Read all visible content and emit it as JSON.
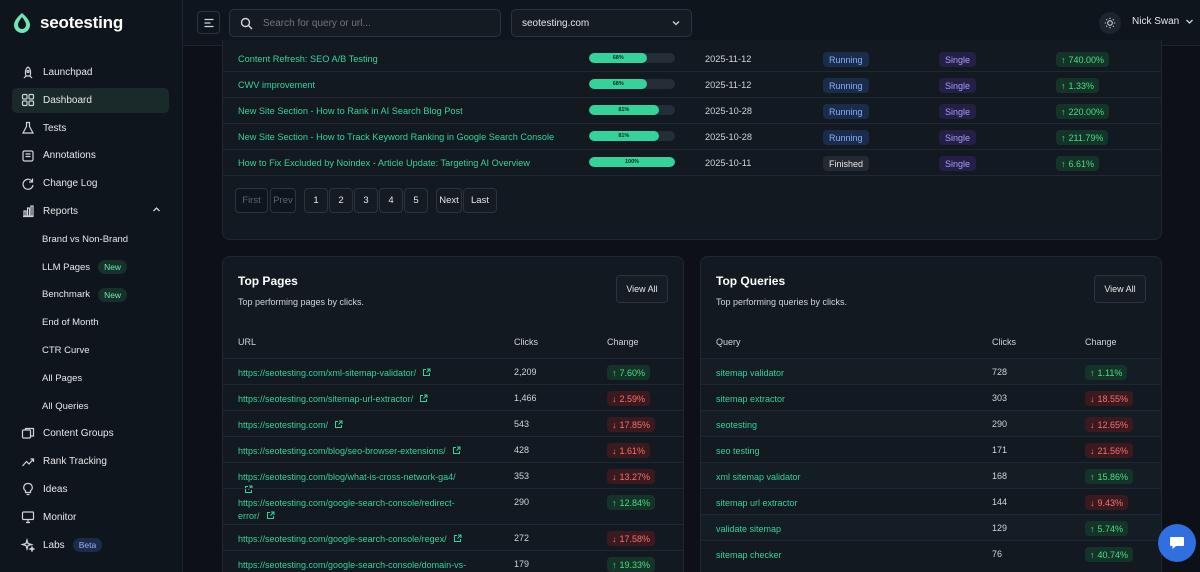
{
  "brand": {
    "name": "seotesting"
  },
  "nav": {
    "items": [
      {
        "label": "Launchpad"
      },
      {
        "label": "Dashboard"
      },
      {
        "label": "Tests"
      },
      {
        "label": "Annotations"
      },
      {
        "label": "Change Log"
      },
      {
        "label": "Reports"
      }
    ],
    "reports_sub": [
      {
        "label": "Brand vs Non-Brand"
      },
      {
        "label": "LLM Pages",
        "pill": "New"
      },
      {
        "label": "Benchmark",
        "pill": "New"
      },
      {
        "label": "End of Month"
      },
      {
        "label": "CTR Curve"
      },
      {
        "label": "All Pages"
      },
      {
        "label": "All Queries"
      }
    ],
    "bottom_items": [
      {
        "label": "Content Groups"
      },
      {
        "label": "Rank Tracking"
      },
      {
        "label": "Ideas"
      },
      {
        "label": "Monitor"
      },
      {
        "label": "Labs",
        "pill": "Beta"
      }
    ]
  },
  "topbar": {
    "search_placeholder": "Search for query or url...",
    "site": "seotesting.com",
    "user": "Nick Swan"
  },
  "tests": [
    {
      "name": "Content Refresh: SEO A/B Testing",
      "progress": 68,
      "progress_label": "68%",
      "date": "2025-11-12",
      "status": "Running",
      "type": "Single",
      "change": "740.00%",
      "dir": "up"
    },
    {
      "name": "CWV improvement",
      "progress": 68,
      "progress_label": "68%",
      "date": "2025-11-12",
      "status": "Running",
      "type": "Single",
      "change": "1.33%",
      "dir": "up"
    },
    {
      "name": "New Site Section - How to Rank in AI Search Blog Post",
      "progress": 81,
      "progress_label": "81%",
      "date": "2025-10-28",
      "status": "Running",
      "type": "Single",
      "change": "220.00%",
      "dir": "up"
    },
    {
      "name": "New Site Section - How to Track Keyword Ranking in Google Search Console",
      "progress": 81,
      "progress_label": "81%",
      "date": "2025-10-28",
      "status": "Running",
      "type": "Single",
      "change": "211.79%",
      "dir": "up"
    },
    {
      "name": "How to Fix Excluded by Noindex - Article Update: Targeting AI Overview",
      "progress": 100,
      "progress_label": "100%",
      "date": "2025-10-11",
      "status": "Finished",
      "type": "Single",
      "change": "6.61%",
      "dir": "up"
    }
  ],
  "pager": {
    "first": "First",
    "prev": "Prev",
    "pages": [
      "1",
      "2",
      "3",
      "4",
      "5"
    ],
    "next": "Next",
    "last": "Last"
  },
  "top_pages": {
    "title": "Top Pages",
    "subtitle": "Top performing pages by clicks.",
    "view_all": "View All",
    "headers": {
      "col1": "URL",
      "col2": "Clicks",
      "col3": "Change"
    },
    "rows": [
      {
        "url": "https://seotesting.com/xml-sitemap-validator/",
        "clicks": "2,209",
        "change": "7.60%",
        "dir": "up"
      },
      {
        "url": "https://seotesting.com/sitemap-url-extractor/",
        "clicks": "1,466",
        "change": "2.59%",
        "dir": "down"
      },
      {
        "url": "https://seotesting.com/",
        "clicks": "543",
        "change": "17.85%",
        "dir": "down"
      },
      {
        "url": "https://seotesting.com/blog/seo-browser-extensions/",
        "clicks": "428",
        "change": "1.61%",
        "dir": "down"
      },
      {
        "url": "https://seotesting.com/blog/what-is-cross-network-ga4/",
        "clicks": "353",
        "change": "13.27%",
        "dir": "down"
      },
      {
        "url": "https://seotesting.com/google-search-console/redirect-error/",
        "clicks": "290",
        "change": "12.84%",
        "dir": "up"
      },
      {
        "url": "https://seotesting.com/google-search-console/regex/",
        "clicks": "272",
        "change": "17.58%",
        "dir": "down"
      },
      {
        "url": "https://seotesting.com/google-search-console/domain-vs-",
        "clicks": "179",
        "change": "19.33%",
        "dir": "up"
      }
    ]
  },
  "top_queries": {
    "title": "Top Queries",
    "subtitle": "Top performing queries by clicks.",
    "view_all": "View All",
    "headers": {
      "col1": "Query",
      "col2": "Clicks",
      "col3": "Change"
    },
    "rows": [
      {
        "query": "sitemap validator",
        "clicks": "728",
        "change": "1.11%",
        "dir": "up"
      },
      {
        "query": "sitemap extractor",
        "clicks": "303",
        "change": "18.55%",
        "dir": "down"
      },
      {
        "query": "seotesting",
        "clicks": "290",
        "change": "12.65%",
        "dir": "down"
      },
      {
        "query": "seo testing",
        "clicks": "171",
        "change": "21.56%",
        "dir": "down"
      },
      {
        "query": "xml sitemap validator",
        "clicks": "168",
        "change": "15.86%",
        "dir": "up"
      },
      {
        "query": "sitemap url extractor",
        "clicks": "144",
        "change": "9.43%",
        "dir": "down"
      },
      {
        "query": "validate sitemap",
        "clicks": "129",
        "change": "5.74%",
        "dir": "up"
      },
      {
        "query": "sitemap checker",
        "clicks": "76",
        "change": "40.74%",
        "dir": "up"
      }
    ]
  },
  "icons": {
    "launchpad": "rocket-icon",
    "dashboard": "grid-icon",
    "tests": "flask-icon",
    "annotations": "note-icon",
    "changelog": "refresh-icon",
    "reports": "bar-chart-icon",
    "content_groups": "folders-icon",
    "rank_tracking": "trend-icon",
    "ideas": "lightbulb-icon",
    "monitor": "monitor-icon",
    "labs": "sparkles-icon"
  },
  "colors": {
    "accent": "#34d399",
    "up": "#4ade80",
    "down": "#f87171",
    "running": "#7fb0ff",
    "single": "#a59bff"
  }
}
